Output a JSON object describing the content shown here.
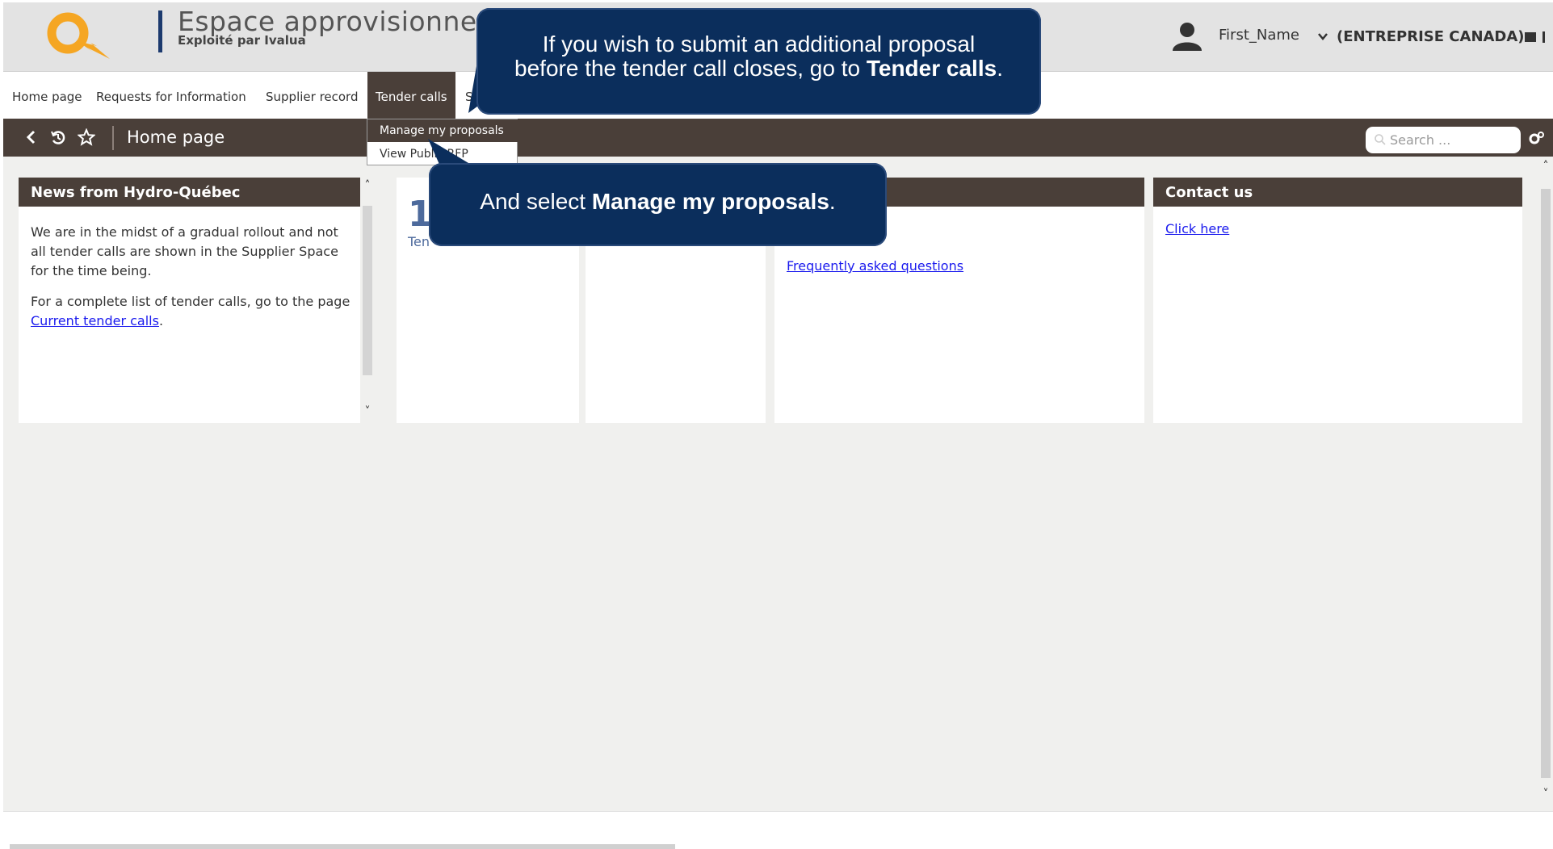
{
  "header": {
    "brand_title": "Espace approvisionnement",
    "brand_subtitle": "Exploité par Ivalua",
    "user_name": "First_Name",
    "company": "(ENTREPRISE CANADA)"
  },
  "menu": {
    "items": [
      {
        "label": "Home page"
      },
      {
        "label": "Requests for Information"
      },
      {
        "label": "Supplier record"
      },
      {
        "label": "Tender calls"
      },
      {
        "label": "S"
      }
    ]
  },
  "dropdown": {
    "items": [
      {
        "label": "Manage my proposals"
      },
      {
        "label": "View Public RFP"
      }
    ]
  },
  "toolbar": {
    "title": "Home page",
    "search_placeholder": "Search ..."
  },
  "panels": {
    "news": {
      "title": "News from Hydro-Québec",
      "para1": "We are in the midst of a gradual rollout and not all tender calls are shown in the Supplier Space for the time being.",
      "para2_prefix": "For a complete list of tender calls, go to the page ",
      "para2_link": "Current tender calls",
      "para2_suffix": "."
    },
    "tenders": {
      "number": "10",
      "label": "Ten"
    },
    "help": {
      "link": "Frequently asked questions"
    },
    "contact": {
      "title": "Contact us",
      "link": "Click here"
    }
  },
  "callouts": {
    "first_line1": "If you wish to submit an additional proposal",
    "first_line2_prefix": "before the tender call closes, go to ",
    "first_line2_bold": "Tender calls",
    "first_line2_suffix": ".",
    "second_prefix": "And select ",
    "second_bold": "Manage my proposals",
    "second_suffix": "."
  },
  "colors": {
    "toolbar_bg": "#4a3f39",
    "callout_bg": "#0b2e5c",
    "link": "#1a1aee",
    "logo_orange": "#f5a623"
  }
}
